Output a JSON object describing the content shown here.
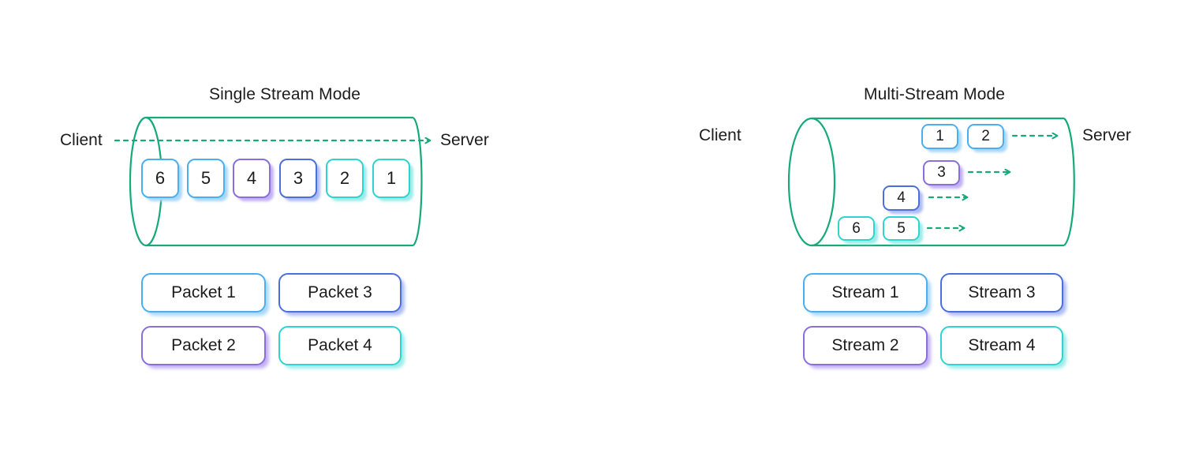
{
  "colors": {
    "tube_green": "#16a97a",
    "arrow_green": "#16a97a",
    "text": "#1c1c1e",
    "background": "#ffffff",
    "stream1_blue": "#4aaef0",
    "stream1_shadow": "#a8d8fa",
    "stream2_purple": "#8a6fdc",
    "stream2_shadow": "#c3b2f2",
    "stream3_indigo": "#4c6fdc",
    "stream3_shadow": "#aebcf5",
    "stream4_cyan": "#2fd3cf",
    "stream4_shadow": "#9cecea"
  },
  "panels": [
    {
      "id": "single-stream",
      "title": "Single Stream Mode",
      "client_label": "Client",
      "server_label": "Server",
      "packets": [
        {
          "label": "6",
          "stream": 1
        },
        {
          "label": "5",
          "stream": 1
        },
        {
          "label": "4",
          "stream": 2
        },
        {
          "label": "3",
          "stream": 3
        },
        {
          "label": "2",
          "stream": 4
        },
        {
          "label": "1",
          "stream": 4
        }
      ],
      "legend": [
        {
          "label": "Packet 1",
          "stream": 1
        },
        {
          "label": "Packet 3",
          "stream": 3
        },
        {
          "label": "Packet 2",
          "stream": 2
        },
        {
          "label": "Packet 4",
          "stream": 4
        }
      ]
    },
    {
      "id": "multi-stream",
      "title": "Multi-Stream Mode",
      "client_label": "Client",
      "server_label": "Server",
      "lanes": [
        {
          "packets": [
            "1",
            "2"
          ],
          "stream": 1
        },
        {
          "packets": [
            "3"
          ],
          "stream": 2
        },
        {
          "packets": [
            "4"
          ],
          "stream": 3
        },
        {
          "packets": [
            "6",
            "5"
          ],
          "stream": 4
        }
      ],
      "legend": [
        {
          "label": "Stream 1",
          "stream": 1
        },
        {
          "label": "Stream 3",
          "stream": 3
        },
        {
          "label": "Stream 2",
          "stream": 2
        },
        {
          "label": "Stream 4",
          "stream": 4
        }
      ]
    }
  ]
}
